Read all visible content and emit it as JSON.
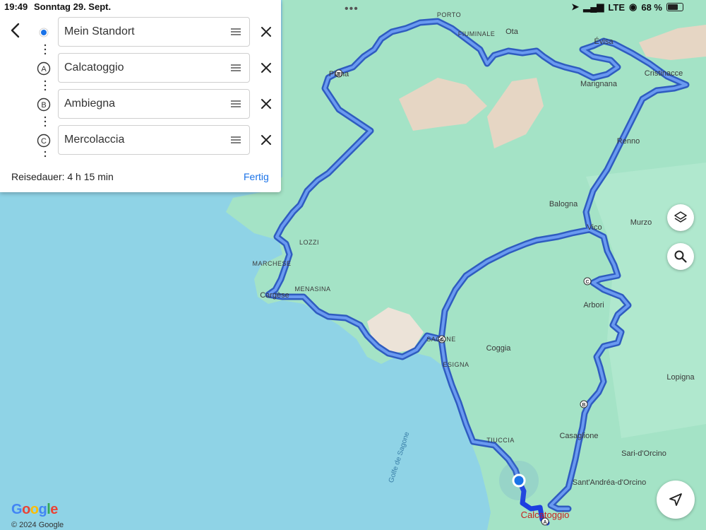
{
  "status_bar": {
    "time": "19:49",
    "date": "Sonntag 29. Sept.",
    "network": "LTE",
    "battery": "68 %"
  },
  "panel": {
    "stops": [
      {
        "marker": "",
        "label": "Mein Standort"
      },
      {
        "marker": "A",
        "label": "Calcatoggio"
      },
      {
        "marker": "B",
        "label": "Ambiegna"
      },
      {
        "marker": "C",
        "label": "Mercolaccia"
      }
    ],
    "duration": "Reisedauer: 4 h 15 min",
    "done_label": "Fertig"
  },
  "map": {
    "route_color": "#4f7fd8",
    "route_casing_color": "#2f5cc0",
    "land_color": "#a4e3c6",
    "water_color": "#8fd3e6",
    "places": [
      {
        "name": "PORTO",
        "style": "caps"
      },
      {
        "name": "FIUMINALE",
        "style": "caps"
      },
      {
        "name": "Ota",
        "style": "normal"
      },
      {
        "name": "Évisa",
        "style": "normal"
      },
      {
        "name": "Cristinacce",
        "style": "normal"
      },
      {
        "name": "Marignana",
        "style": "normal"
      },
      {
        "name": "Piana",
        "style": "normal"
      },
      {
        "name": "Renno",
        "style": "normal"
      },
      {
        "name": "Balogna",
        "style": "normal"
      },
      {
        "name": "Vico",
        "style": "normal"
      },
      {
        "name": "Murzo",
        "style": "normal"
      },
      {
        "name": "LOZZI",
        "style": "caps"
      },
      {
        "name": "MARCHESE",
        "style": "caps"
      },
      {
        "name": "Cargèse",
        "style": "normal"
      },
      {
        "name": "MENASINA",
        "style": "caps"
      },
      {
        "name": "Arbori",
        "style": "normal"
      },
      {
        "name": "SAGONE",
        "style": "caps"
      },
      {
        "name": "Coggia",
        "style": "normal"
      },
      {
        "name": "ESIGNA",
        "style": "caps"
      },
      {
        "name": "Lopigna",
        "style": "normal"
      },
      {
        "name": "TIUCCIA",
        "style": "caps"
      },
      {
        "name": "Casaglione",
        "style": "normal"
      },
      {
        "name": "Sari-d'Orcino",
        "style": "normal"
      },
      {
        "name": "Sant'Andréa-d'Orcino",
        "style": "normal"
      },
      {
        "name": "Calcatoggio",
        "style": "destination"
      },
      {
        "name": "Golfe de Sagone",
        "style": "water"
      }
    ],
    "waypoint_markers": [
      "A",
      "B",
      "C",
      "D",
      "F"
    ]
  },
  "controls": [
    "layers-icon",
    "search-icon",
    "recenter-icon"
  ],
  "attribution": {
    "logo": "Google",
    "copyright": "© 2024 Google"
  }
}
